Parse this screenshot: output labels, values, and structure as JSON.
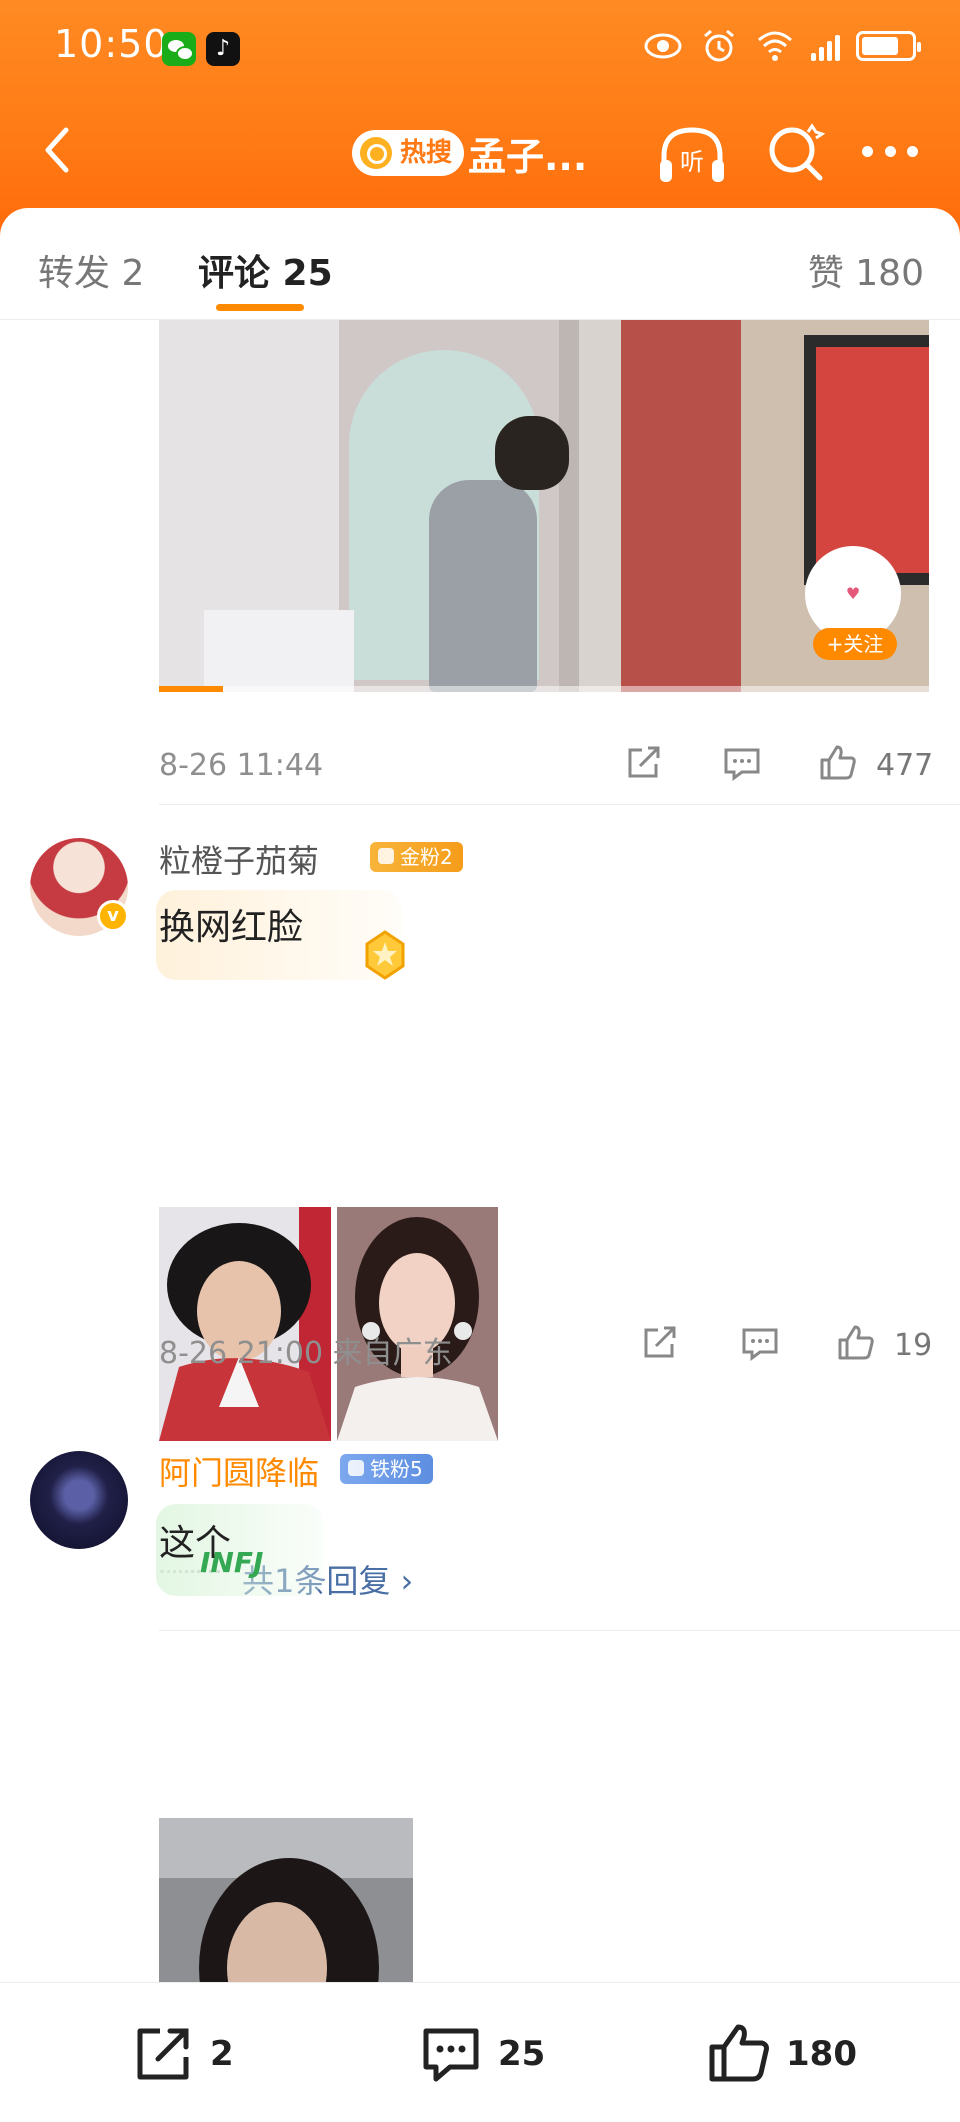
{
  "status_bar": {
    "time": "10:50"
  },
  "nav": {
    "hot_label": "热搜",
    "title": "孟子...",
    "listen_label": "听"
  },
  "tabs": {
    "repost": "转发 2",
    "comment": "评论 25",
    "like": "赞 180"
  },
  "video": {
    "follow_label": "+关注"
  },
  "post_meta": {
    "time": "8-26 11:44",
    "like_count": "477"
  },
  "comments": [
    {
      "username": "粒橙子茄菊",
      "fan_badge": "金粉2",
      "text": "换网红脸",
      "time_location": "8-26 21:00 来自广东",
      "like_count": "19",
      "replies_label": "共1条回复 ›"
    },
    {
      "username": "阿门圆降临",
      "fan_badge": "铁粉5",
      "text": "这个",
      "sticker_text": "INFJ"
    }
  ],
  "bottom_bar": {
    "share_count": "2",
    "comment_count": "25",
    "like_count": "180"
  },
  "colors": {
    "accent": "#ff8a00",
    "header": "#ff7a14",
    "link": "#4a6fa5"
  }
}
